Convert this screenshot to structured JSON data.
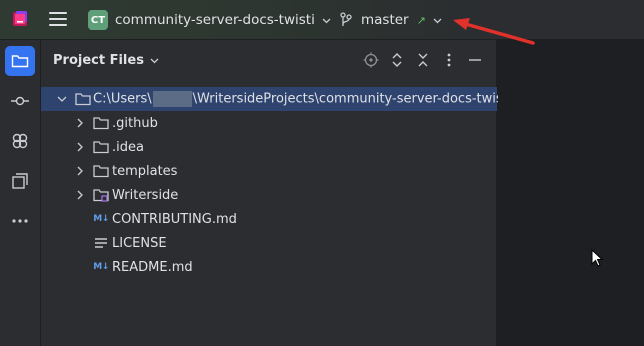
{
  "titlebar": {
    "project_badge": "CT",
    "project_name": "community-server-docs-twisti",
    "branch_name": "master",
    "incoming_indicator": "↗"
  },
  "toolstrip": {
    "items": [
      {
        "name": "project-tool",
        "icon": "folder-icon",
        "active": true
      },
      {
        "name": "commit-tool",
        "icon": "commit-icon",
        "active": false
      },
      {
        "name": "plugins-tool",
        "icon": "plugins-icon",
        "active": false
      },
      {
        "name": "structure-tool",
        "icon": "layers-icon",
        "active": false
      },
      {
        "name": "more-tools",
        "icon": "more-icon",
        "active": false
      }
    ]
  },
  "panel": {
    "title": "Project Files",
    "header_icons": [
      "locate-icon",
      "expand-all-icon",
      "collapse-all-icon",
      "options-icon",
      "hide-icon"
    ]
  },
  "tree": {
    "root": {
      "prefix": "C:\\Users\\",
      "suffix": "\\WritersideProjects\\community-server-docs-twisti"
    },
    "items": [
      {
        "label": ".github",
        "type": "folder"
      },
      {
        "label": ".idea",
        "type": "folder"
      },
      {
        "label": "templates",
        "type": "folder"
      },
      {
        "label": "Writerside",
        "type": "writerside-folder"
      },
      {
        "label": "CONTRIBUTING.md",
        "type": "markdown",
        "icon_text": "M↓"
      },
      {
        "label": "LICENSE",
        "type": "text"
      },
      {
        "label": "README.md",
        "type": "markdown",
        "icon_text": "M↓"
      }
    ]
  },
  "colors": {
    "accent": "#3574f0",
    "selection": "#2e436e",
    "badge": "#5fa07a",
    "annotation": "#e0322a"
  }
}
